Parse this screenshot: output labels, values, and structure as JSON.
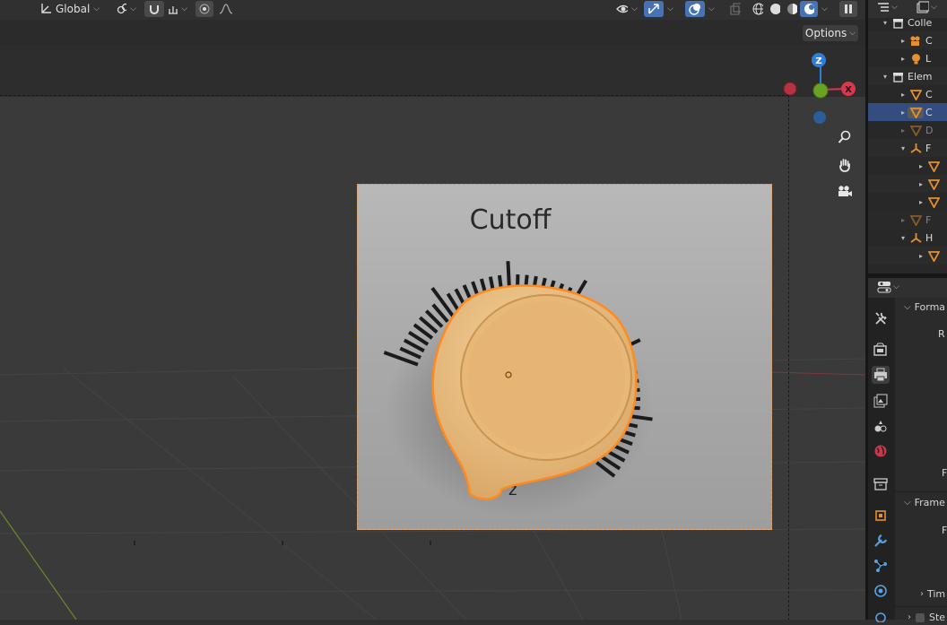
{
  "viewport_header": {
    "transform_orientation": "Global",
    "options_label": "Options"
  },
  "gizmo": {
    "axis_z": "Z",
    "axis_x": "X",
    "colors": {
      "x": "#e0344c",
      "y": "#6aa323",
      "z": "#2f7fd8",
      "neg": "#b53244"
    }
  },
  "reference_image": {
    "title": "Cutoff",
    "partial_text": "z",
    "knob_color": "#e9b878"
  },
  "outliner": {
    "rows": [
      {
        "label": "Colle",
        "indent": 1,
        "icon": "collection-icon"
      },
      {
        "label": "C",
        "indent": 2,
        "icon": "camera-icon"
      },
      {
        "label": "L",
        "indent": 2,
        "icon": "light-icon"
      },
      {
        "label": "Elem",
        "indent": 1,
        "icon": "collection-icon"
      },
      {
        "label": "C",
        "indent": 2,
        "icon": "mesh-icon"
      },
      {
        "label": "C",
        "indent": 2,
        "icon": "mesh-icon",
        "selected": true
      },
      {
        "label": "D",
        "indent": 2,
        "icon": "mesh-icon",
        "dim": true
      },
      {
        "label": "F",
        "indent": 2,
        "icon": "empty-icon"
      },
      {
        "label": "",
        "indent": 3,
        "icon": "mesh-icon"
      },
      {
        "label": "",
        "indent": 3,
        "icon": "mesh-icon"
      },
      {
        "label": "",
        "indent": 3,
        "icon": "mesh-icon"
      },
      {
        "label": "F",
        "indent": 2,
        "icon": "mesh-icon",
        "dim": true
      },
      {
        "label": "H",
        "indent": 2,
        "icon": "empty-icon"
      },
      {
        "label": "",
        "indent": 3,
        "icon": "mesh-icon"
      }
    ]
  },
  "properties": {
    "format_label": "Forma",
    "res_label": "R",
    "f_label": "F",
    "frame_label": "Frame",
    "frame_f_label": "F",
    "time_label": "Tim",
    "ste_label": "Ste"
  }
}
